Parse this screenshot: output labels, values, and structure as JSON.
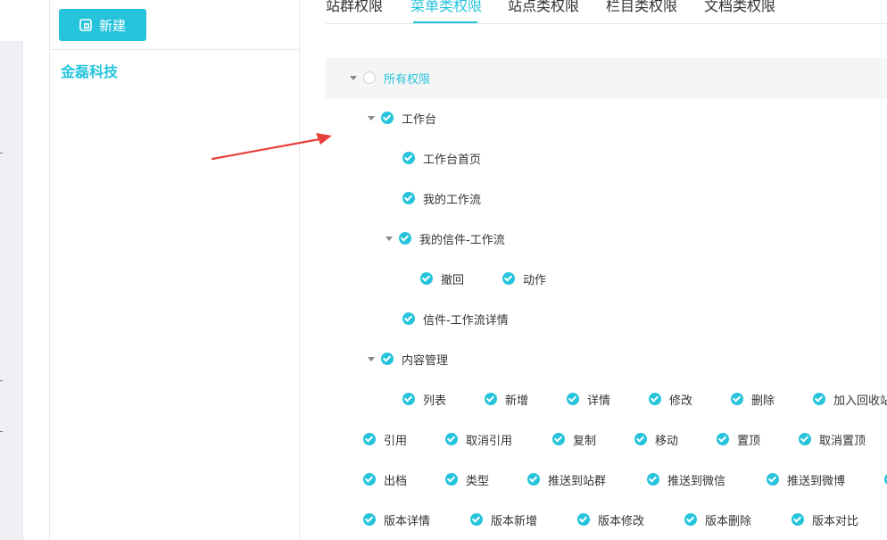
{
  "org_panel": {
    "new_button_label": "新建",
    "org_name": "金磊科技"
  },
  "tabs": [
    {
      "label": "站群权限",
      "active": false
    },
    {
      "label": "菜单类权限",
      "active": true
    },
    {
      "label": "站点类权限",
      "active": false
    },
    {
      "label": "栏目类权限",
      "active": false
    },
    {
      "label": "文档类权限",
      "active": false
    }
  ],
  "tree": {
    "root": {
      "label": "所有权限",
      "checked": false
    },
    "workbench": {
      "label": "工作台",
      "children": {
        "home": "工作台首页",
        "my_workflow": "我的工作流",
        "my_letters_workflow": {
          "label": "我的信件-工作流",
          "actions": [
            "撤回",
            "动作"
          ]
        },
        "letter_workflow_detail": "信件-工作流详情"
      }
    },
    "content_management": {
      "label": "内容管理",
      "action_rows": [
        [
          "列表",
          "新增",
          "详情",
          "修改",
          "删除",
          "加入回收站"
        ],
        [
          "引用",
          "取消引用",
          "复制",
          "移动",
          "置顶",
          "取消置顶"
        ],
        [
          "出档",
          "类型",
          "推送到站群",
          "推送到微信",
          "推送到微博"
        ],
        [
          "版本详情",
          "版本新增",
          "版本修改",
          "版本删除",
          "版本对比"
        ]
      ]
    }
  },
  "colors": {
    "accent": "#26c4dc",
    "annotation_arrow": "#e8403a"
  }
}
